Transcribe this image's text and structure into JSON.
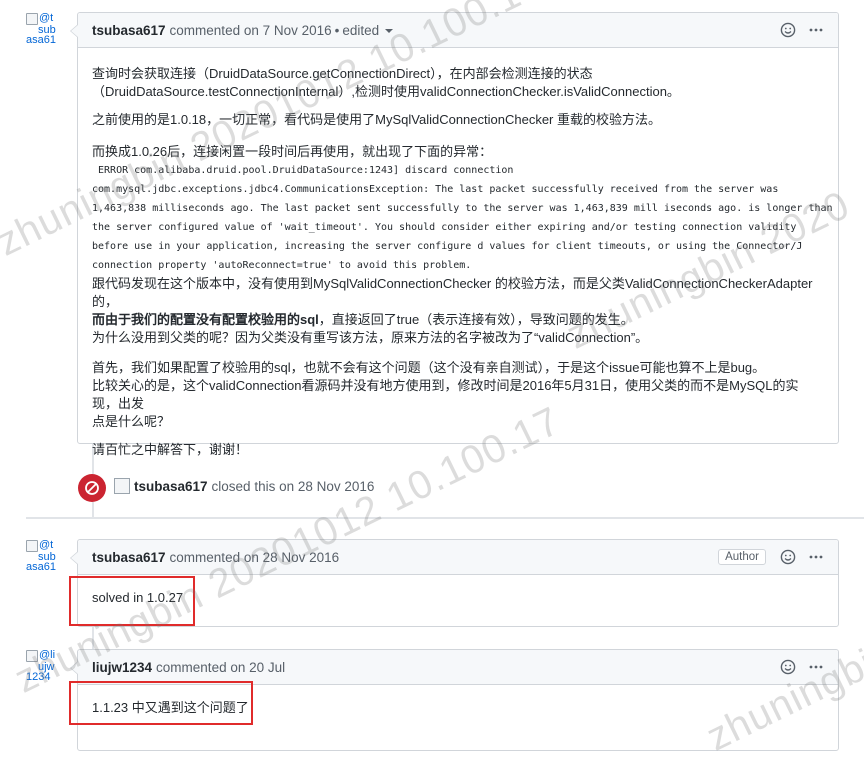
{
  "comment1": {
    "avatar_alt": [
      "@t",
      "sub",
      "asa61"
    ],
    "author": "tsubasa617",
    "action": "commented on 7 Nov 2016",
    "edited": "edited",
    "body": {
      "p1_line1": "查询时会获取连接（DruidDataSource.getConnectionDirect），在内部会检测连接的状态",
      "p1_line2": "（DruidDataSource.testConnectionInternal）,检测时使用validConnectionChecker.isValidConnection。",
      "p2": "之前使用的是1.0.18，一切正常，看代码是使用了MySqlValidConnectionChecker 重载的校验方法。",
      "p3": "而换成1.0.26后，连接闲置一段时间后再使用，就出现了下面的异常：",
      "log": [
        " ERROR com.alibaba.druid.pool.DruidDataSource:1243] discard connection",
        "com.mysql.jdbc.exceptions.jdbc4.CommunicationsException: The last packet successfully received from the server was",
        "1,463,838 milliseconds ago. The last packet sent successfully to the server was 1,463,839 mill iseconds ago. is longer than",
        "the server configured value of 'wait_timeout'. You should consider either expiring and/or testing connection validity",
        "before use in your application, increasing the server configure d values for client timeouts, or using the Connector/J",
        "connection property 'autoReconnect=true' to avoid this problem."
      ],
      "p4_line1": "跟代码发现在这个版本中，没有使用到MySqlValidConnectionChecker 的校验方法，而是父类ValidConnectionCheckerAdapter 的，",
      "p4_line2_bold": "而由于我们的配置没有配置校验用的sql",
      "p4_line2_rest": "，直接返回了true（表示连接有效），导致问题的发生。",
      "p4_line3": "为什么没用到父类的呢？因为父类没有重写该方法，原来方法的名字被改为了“validConnection”。",
      "p5_line1": "首先，我们如果配置了校验用的sql，也就不会有这个问题（这个没有亲自测试），于是这个issue可能也算不上是bug。",
      "p5_line2": "比较关心的是，这个validConnection看源码并没有地方使用到，修改时间是2016年5月31日，使用父类的而不是MySQL的实现，出发",
      "p5_line3": "点是什么呢？",
      "p6": "请百忙之中解答下，谢谢！"
    }
  },
  "event": {
    "author": "tsubasa617",
    "action": "closed this on 28 Nov 2016"
  },
  "comment2": {
    "avatar_alt": [
      "@t",
      "sub",
      "asa61"
    ],
    "author": "tsubasa617",
    "action": "commented on 28 Nov 2016",
    "badge": "Author",
    "body": "solved in 1.0.27"
  },
  "comment3": {
    "avatar_alt": [
      "@li",
      "ujw",
      "1234"
    ],
    "author": "liujw1234",
    "action": "commented on 20 Jul",
    "body": "1.1.23 中又遇到这个问题了"
  },
  "watermark": {
    "text1": "zhuningbin 20201012 10.100.1",
    "text2": "zhuningbin 20201012 10.100.17",
    "text3": "zhuningbin 2020",
    "text4": "zhuningbin"
  },
  "colors": {
    "closed_red": "#cb2431",
    "highlight_box": "#e02b2b",
    "link_blue": "#0366d6"
  }
}
